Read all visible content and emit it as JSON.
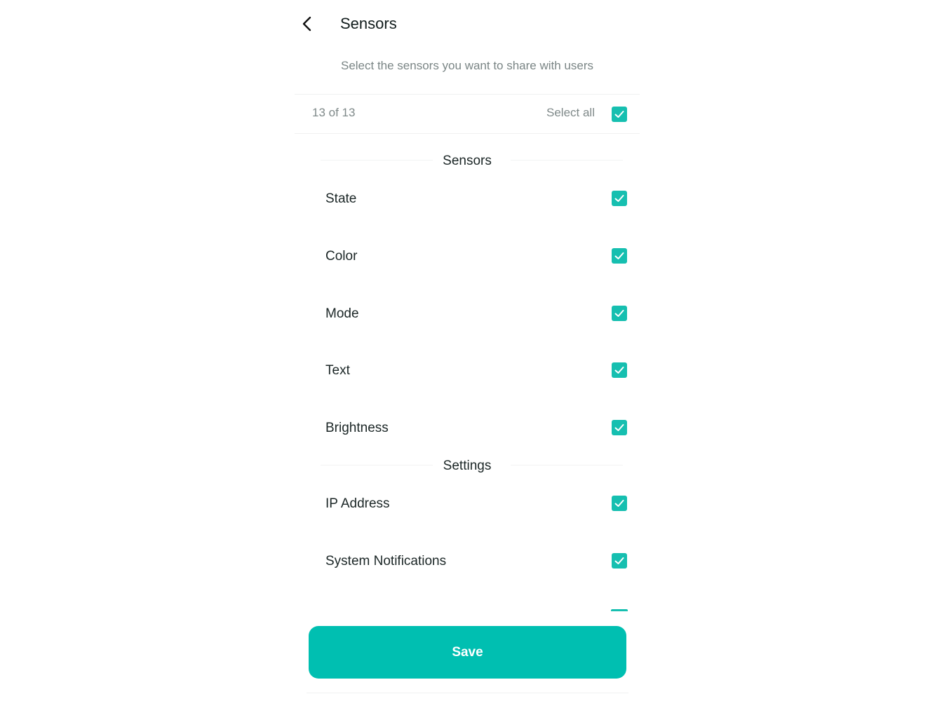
{
  "header": {
    "title": "Sensors",
    "subtitle": "Select the sensors you want to share with users",
    "back_icon": "chevron-left-icon"
  },
  "selection": {
    "count_text": "13 of 13",
    "select_all_label": "Select all",
    "select_all_checked": true
  },
  "sections": [
    {
      "title": "Sensors",
      "items": [
        {
          "label": "State",
          "checked": true
        },
        {
          "label": "Color",
          "checked": true
        },
        {
          "label": "Mode",
          "checked": true
        },
        {
          "label": "Text",
          "checked": true
        },
        {
          "label": "Brightness",
          "checked": true
        }
      ]
    },
    {
      "title": "Settings",
      "items": [
        {
          "label": "IP Address",
          "checked": true
        },
        {
          "label": "System Notifications",
          "checked": true
        }
      ]
    }
  ],
  "footer": {
    "save_label": "Save"
  },
  "colors": {
    "accent": "#00bfb1",
    "checkbox": "#16bfb0",
    "muted_text": "#7a8585"
  }
}
